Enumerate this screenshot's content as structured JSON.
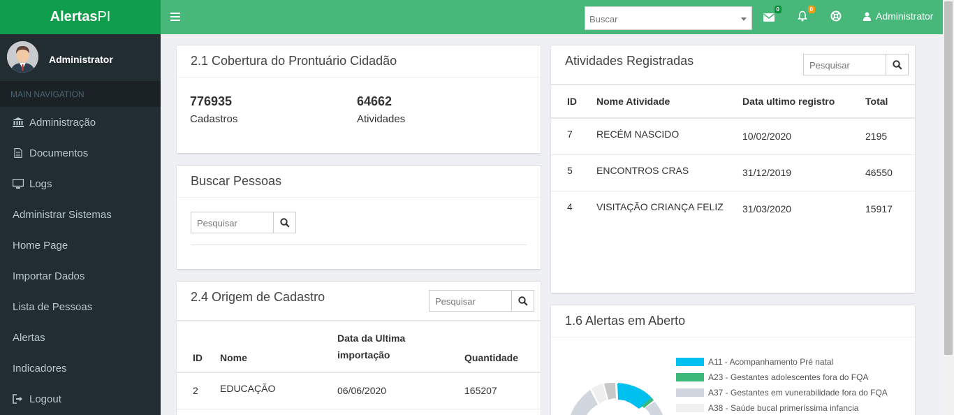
{
  "brand": {
    "bold": "Alertas",
    "lite": "PI"
  },
  "topbar": {
    "search_placeholder": "Buscar",
    "messages_count": "0",
    "notifications_count": "0",
    "user_label": "Administrator"
  },
  "sidebar": {
    "user_name": "Administrator",
    "nav_header": "MAIN NAVIGATION",
    "items": [
      {
        "label": "Administração",
        "icon": "bank-icon"
      },
      {
        "label": "Documentos",
        "icon": "document-icon"
      },
      {
        "label": "Logs",
        "icon": "monitor-icon"
      },
      {
        "label": "Administrar Sistemas",
        "icon": ""
      },
      {
        "label": "Home Page",
        "icon": ""
      },
      {
        "label": "Importar Dados",
        "icon": ""
      },
      {
        "label": "Lista de Pessoas",
        "icon": ""
      },
      {
        "label": "Alertas",
        "icon": ""
      },
      {
        "label": "Indicadores",
        "icon": ""
      },
      {
        "label": "Logout",
        "icon": "sign-out-icon"
      }
    ]
  },
  "cobertura": {
    "title": "2.1 Cobertura do Prontuário Cidadão",
    "cadastros_value": "776935",
    "cadastros_label": "Cadastros",
    "atividades_value": "64662",
    "atividades_label": "Atividades"
  },
  "buscar": {
    "title": "Buscar Pessoas",
    "placeholder": "Pesquisar"
  },
  "origem": {
    "title": "2.4 Origem de Cadastro",
    "placeholder": "Pesquisar",
    "headers": {
      "id": "ID",
      "nome": "Nome",
      "data_line1": "Data da Ultima",
      "data_line2": "importação",
      "qtd": "Quantidade"
    },
    "rows": [
      {
        "id": "2",
        "nome": "EDUCAÇÃO",
        "data": "06/06/2020",
        "qtd": "165207"
      }
    ]
  },
  "atividades": {
    "title": "Atividades Registradas",
    "placeholder": "Pesquisar",
    "headers": {
      "id": "ID",
      "nome": "Nome Atividade",
      "data": "Data ultimo registro",
      "total": "Total"
    },
    "rows": [
      {
        "id": "7",
        "nome": "RECÉM NASCIDO",
        "data": "10/02/2020",
        "total": "2195"
      },
      {
        "id": "5",
        "nome": "ENCONTROS CRAS",
        "data": "31/12/2019",
        "total": "46550"
      },
      {
        "id": "4",
        "nome": "VISITAÇÃO CRIANÇA FELIZ",
        "data": "31/03/2020",
        "total": "15917"
      }
    ]
  },
  "alertas": {
    "title": "1.6 Alertas em Aberto",
    "legend": [
      {
        "label": "A11 - Acompanhamento Pré natal",
        "color": "#00c0ef"
      },
      {
        "label": "A23 - Gestantes adolescentes fora do FQA",
        "color": "#3cb878"
      },
      {
        "label": "A37 - Gestantes em vunerabilidade fora do FQA",
        "color": "#d2d6de"
      },
      {
        "label": "A38 - Saúde bucal primeríssima infancia",
        "color": "#efefef"
      }
    ]
  },
  "colors": {
    "brand": "#0f9e4b",
    "topbar": "#47b77a",
    "sidebar": "#222d32"
  }
}
